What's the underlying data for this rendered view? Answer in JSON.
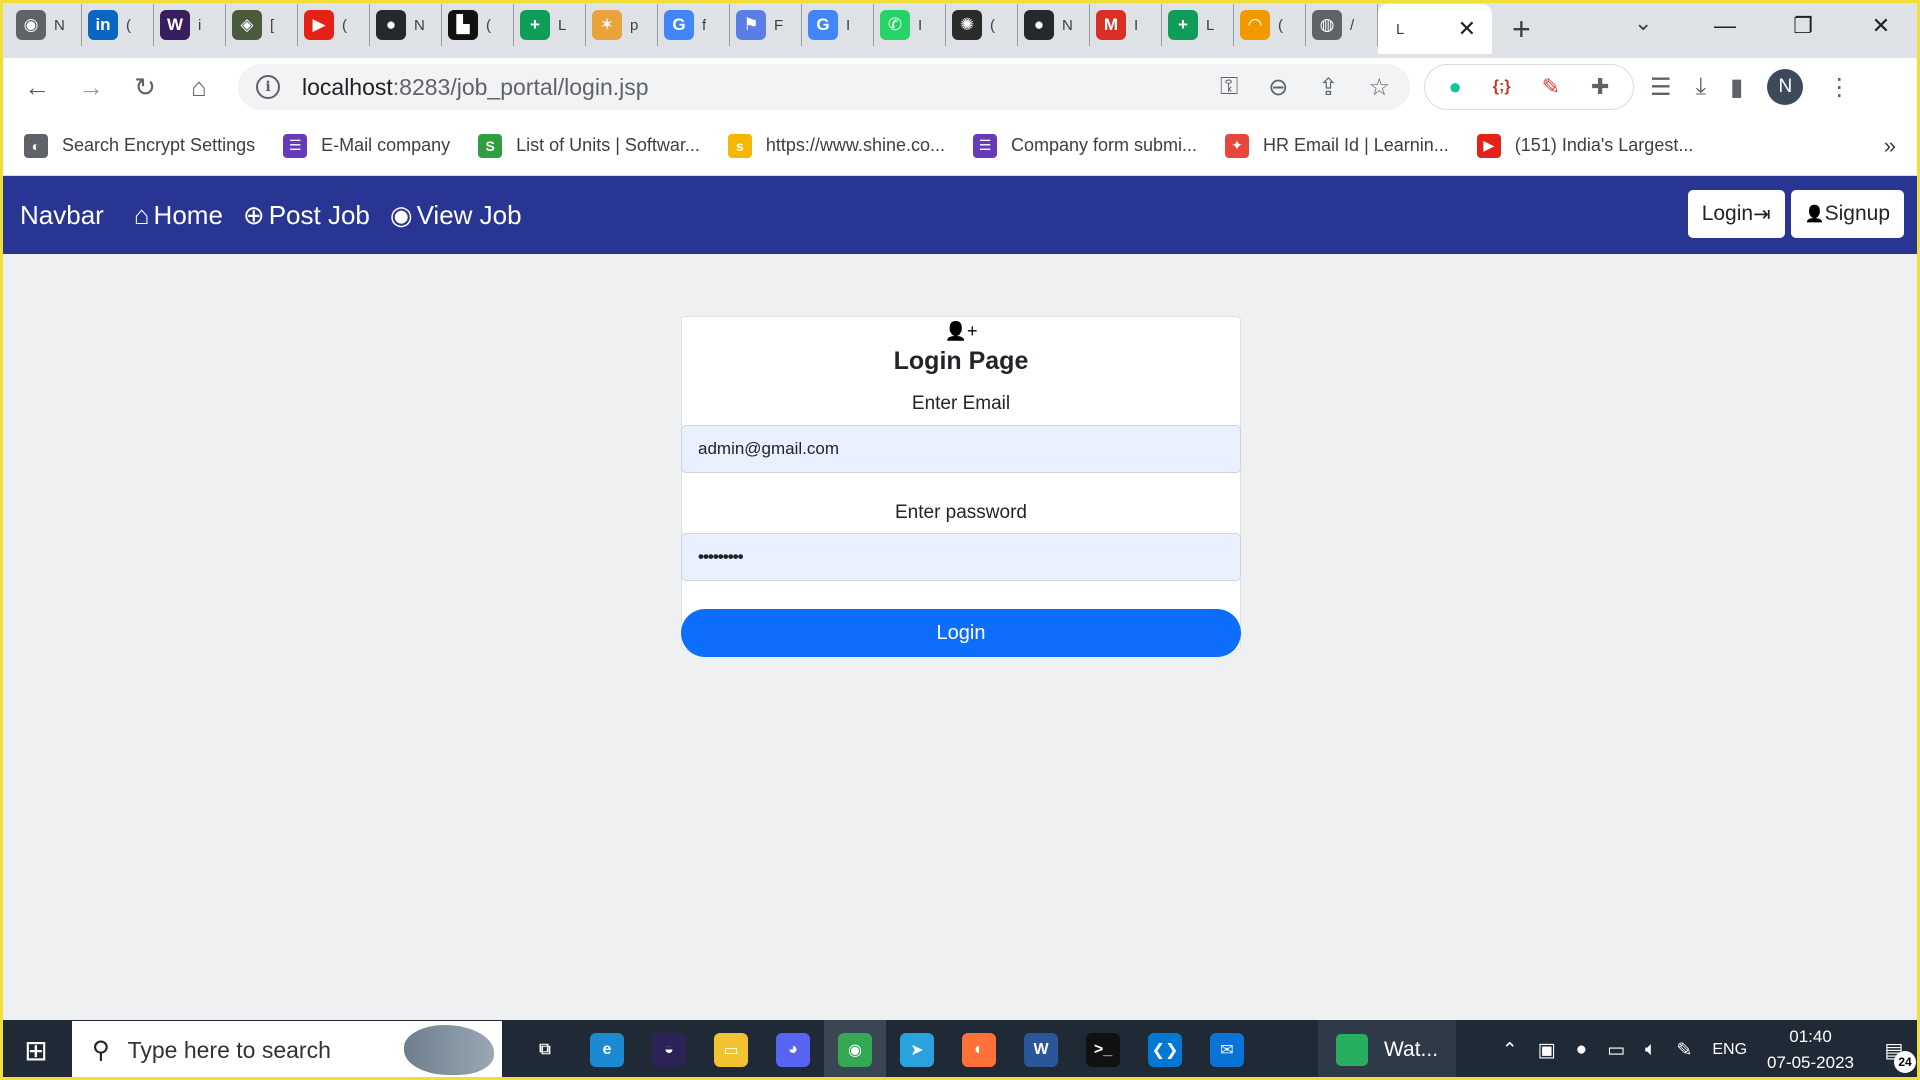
{
  "browser": {
    "tabs": [
      {
        "icon": "chrome-icon",
        "glyph": "◉",
        "bg": "#5f6368",
        "title": "N"
      },
      {
        "icon": "linkedin-icon",
        "glyph": "in",
        "bg": "#0a66c2",
        "title": "("
      },
      {
        "icon": "wikipedia-icon",
        "glyph": "W",
        "bg": "#3a1d5c",
        "title": "i"
      },
      {
        "icon": "diamond-site-icon",
        "glyph": "◈",
        "bg": "#4a5a3a",
        "title": "["
      },
      {
        "icon": "youtube-icon",
        "glyph": "▶",
        "bg": "#e62117",
        "title": "("
      },
      {
        "icon": "github-icon",
        "glyph": "●",
        "bg": "#24292e",
        "title": "N"
      },
      {
        "icon": "site-icon",
        "glyph": "▙",
        "bg": "#111111",
        "title": "("
      },
      {
        "icon": "sheets-plus-icon",
        "glyph": "+",
        "bg": "#0f9d58",
        "title": "L"
      },
      {
        "icon": "colorful-icon",
        "glyph": "✶",
        "bg": "#e8a33d",
        "title": "p"
      },
      {
        "icon": "google-icon",
        "glyph": "G",
        "bg": "#4285f4",
        "title": "f"
      },
      {
        "icon": "flag-icon",
        "glyph": "⚑",
        "bg": "#5b7de6",
        "title": "F"
      },
      {
        "icon": "google-icon",
        "glyph": "G",
        "bg": "#4285f4",
        "title": "I"
      },
      {
        "icon": "whatsapp-icon",
        "glyph": "✆",
        "bg": "#25d366",
        "title": "I"
      },
      {
        "icon": "openai-icon",
        "glyph": "✺",
        "bg": "#2b2b2b",
        "title": "("
      },
      {
        "icon": "github-icon",
        "glyph": "●",
        "bg": "#24292e",
        "title": "N"
      },
      {
        "icon": "gmail-icon",
        "glyph": "M",
        "bg": "#d93025",
        "title": "I"
      },
      {
        "icon": "sheets-plus-icon",
        "glyph": "+",
        "bg": "#0f9d58",
        "title": "L"
      },
      {
        "icon": "rainbow-icon",
        "glyph": "◠",
        "bg": "#f29900",
        "title": "("
      },
      {
        "icon": "globe-icon",
        "glyph": "◍",
        "bg": "#5f6368",
        "title": "/"
      }
    ],
    "active_tab": {
      "title": "L",
      "close": "✕"
    },
    "new_tab": "+",
    "url_host": "localhost",
    "url_rest": ":8283/job_portal/login.jsp",
    "profile_initial": "N",
    "bookmarks": [
      {
        "icon": "globe-icon",
        "bg": "#5f6368",
        "glyph": "◐",
        "label": "Search Encrypt Settings"
      },
      {
        "icon": "forms-icon",
        "bg": "#673ab7",
        "glyph": "☰",
        "label": "E-Mail company"
      },
      {
        "icon": "dollar-icon",
        "bg": "#2e9e3e",
        "glyph": "S",
        "label": "List of Units | Softwar..."
      },
      {
        "icon": "shine-icon",
        "bg": "#f5b800",
        "glyph": "s",
        "label": "https://www.shine.co..."
      },
      {
        "icon": "forms-icon",
        "bg": "#673ab7",
        "glyph": "☰",
        "label": "Company form submi..."
      },
      {
        "icon": "learning-icon",
        "bg": "#e8453c",
        "glyph": "✦",
        "label": "HR Email Id | Learnin..."
      },
      {
        "icon": "youtube-icon",
        "bg": "#e62117",
        "glyph": "▶",
        "label": "(151) India's Largest..."
      }
    ],
    "bookmarks_more": "»"
  },
  "navbar": {
    "brand": "Navbar",
    "links": [
      {
        "icon": "home-icon",
        "glyph": "⌂",
        "label": "Home"
      },
      {
        "icon": "plus-circle-icon",
        "glyph": "⊕",
        "label": "Post Job"
      },
      {
        "icon": "eye-icon",
        "glyph": "◉",
        "label": "View Job"
      }
    ],
    "login_label": "Login",
    "login_glyph": "⇥",
    "signup_glyph": "👤",
    "signup_label": "Signup"
  },
  "login_card": {
    "icon_glyph": "👤+",
    "title": "Login Page",
    "email_label": "Enter Email",
    "email_value": "admin@gmail.com",
    "password_label": "Enter password",
    "password_value": "•••••••••",
    "submit_label": "Login"
  },
  "taskbar": {
    "search_placeholder": "Type here to search",
    "apps": [
      {
        "icon": "task-view-icon",
        "glyph": "⧉",
        "bg": "transparent"
      },
      {
        "icon": "edge-icon",
        "glyph": "e",
        "bg": "#1b8ad3"
      },
      {
        "icon": "eclipse-icon",
        "glyph": "◒",
        "bg": "#2c2255"
      },
      {
        "icon": "file-explorer-icon",
        "glyph": "▭",
        "bg": "#f2c230"
      },
      {
        "icon": "discord-icon",
        "glyph": "◕",
        "bg": "#5865f2"
      },
      {
        "icon": "chrome-icon",
        "glyph": "◉",
        "bg": "#34a853"
      },
      {
        "icon": "telegram-icon",
        "glyph": "➤",
        "bg": "#2aa3dd"
      },
      {
        "icon": "firefox-icon",
        "glyph": "◐",
        "bg": "#ff7139"
      },
      {
        "icon": "word-icon",
        "glyph": "W",
        "bg": "#2b579a"
      },
      {
        "icon": "terminal-icon",
        "glyph": ">_",
        "bg": "#111111"
      },
      {
        "icon": "vscode-icon",
        "glyph": "❮❯",
        "bg": "#0078d4"
      },
      {
        "icon": "mail-icon",
        "glyph": "✉",
        "bg": "#0a74d6"
      }
    ],
    "pinned_window": "Wat...",
    "language": "ENG",
    "time": "01:40",
    "date": "07-05-2023",
    "notification_count": "24"
  }
}
